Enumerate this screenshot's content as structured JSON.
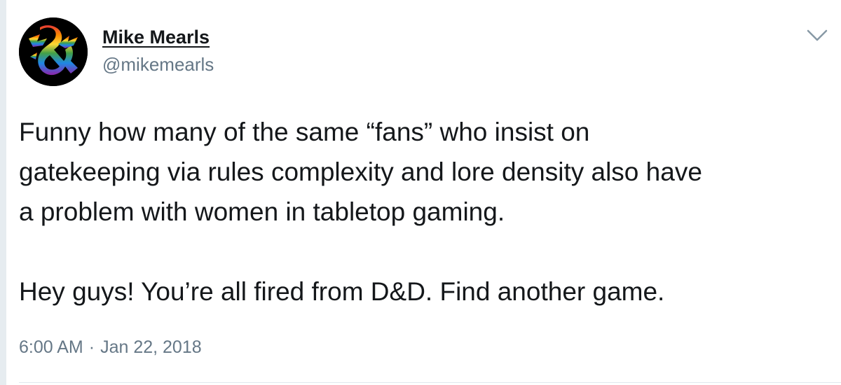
{
  "tweet": {
    "author": {
      "name": "Mike Mearls",
      "handle": "@mikemearls"
    },
    "text": {
      "paragraph_1_lines": [
        "Funny how many of the same “fans” who insist on",
        "gatekeeping via rules complexity and lore density also have",
        "a problem with women in tabletop gaming."
      ],
      "paragraph_2_lines": [
        "Hey guys! You’re all fired from D&D. Find another game."
      ]
    },
    "timestamp": {
      "time": "6:00 AM",
      "separator": "·",
      "date": "Jan 22, 2018"
    },
    "menu_icon": "chevron-down-icon",
    "avatar_icon": "rainbow-ampersand-dragon-logo"
  },
  "colors": {
    "text_primary": "#14171a",
    "text_secondary": "#657786",
    "background": "#ffffff",
    "rail": "#e6ecf0",
    "divider": "#e1e8ed"
  }
}
